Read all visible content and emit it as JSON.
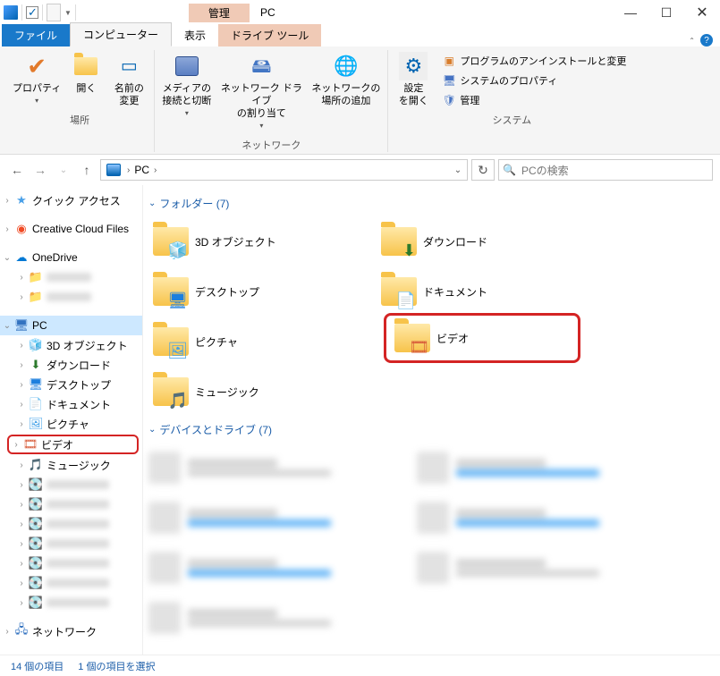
{
  "title": {
    "context_tab": "管理",
    "window_name": "PC"
  },
  "window_controls": {
    "min": "—",
    "max": "☐",
    "close": "✕"
  },
  "tabs": {
    "file": "ファイル",
    "computer": "コンピューター",
    "view": "表示",
    "drive_tools": "ドライブ ツール"
  },
  "ribbon": {
    "group_location": {
      "label": "場所",
      "properties": "プロパティ",
      "open": "開く",
      "rename": "名前の\n変更"
    },
    "group_network": {
      "label": "ネットワーク",
      "media": "メディアの\n接続と切断",
      "map_drive": "ネットワーク ドライブ\nの割り当て",
      "add_location": "ネットワークの\n場所の追加"
    },
    "group_system": {
      "label": "システム",
      "settings": "設定\nを開く",
      "uninstall": "プログラムのアンインストールと変更",
      "sysprops": "システムのプロパティ",
      "manage": "管理"
    }
  },
  "nav": {
    "back": "←",
    "forward": "→",
    "up": "↑"
  },
  "address": {
    "root": "PC"
  },
  "search": {
    "placeholder": "PCの検索"
  },
  "tree": {
    "quick_access": "クイック アクセス",
    "creative_cloud": "Creative Cloud Files",
    "onedrive": "OneDrive",
    "pc": "PC",
    "objects3d": "3D オブジェクト",
    "downloads": "ダウンロード",
    "desktop": "デスクトップ",
    "documents": "ドキュメント",
    "pictures": "ピクチャ",
    "videos": "ビデオ",
    "music": "ミュージック",
    "network": "ネットワーク"
  },
  "content": {
    "section_folders": "フォルダー (7)",
    "folders": {
      "objects3d": "3D オブジェクト",
      "downloads": "ダウンロード",
      "desktop": "デスクトップ",
      "documents": "ドキュメント",
      "pictures": "ピクチャ",
      "videos": "ビデオ",
      "music": "ミュージック"
    },
    "section_drives": "デバイスとドライブ (7)"
  },
  "status": {
    "items": "14 個の項目",
    "selected": "1 個の項目を選択"
  }
}
